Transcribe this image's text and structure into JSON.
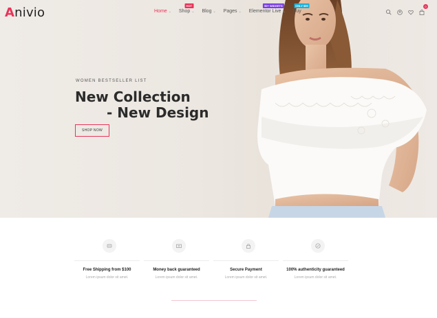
{
  "header": {
    "logo_first": "A",
    "logo_rest": "nivio",
    "nav": [
      {
        "label": "Home",
        "active": true,
        "dropdown": true,
        "badge": ""
      },
      {
        "label": "Shop",
        "active": false,
        "dropdown": true,
        "badge": "HOT",
        "badge_color": "#e8345a"
      },
      {
        "label": "Blog",
        "active": false,
        "dropdown": true,
        "badge": ""
      },
      {
        "label": "Pages",
        "active": false,
        "dropdown": true,
        "badge": ""
      },
      {
        "label": "Elementor Live",
        "active": false,
        "dropdown": true,
        "badge": "50+ WIDGETS",
        "badge_color": "#7b3fe4"
      },
      {
        "label": "Buy",
        "active": false,
        "dropdown": false,
        "badge": "ONLY $59",
        "badge_color": "#1ab0d8"
      }
    ],
    "icons": [
      "search-icon",
      "user-icon",
      "heart-icon",
      "cart-icon"
    ],
    "cart_count": "0"
  },
  "hero": {
    "eyebrow": "WOMEN BESTSELLER LIST",
    "title_line1": "New Collection",
    "title_line2": "- New Design",
    "button": "SHOP NOW"
  },
  "features": [
    {
      "icon": "truck-icon",
      "title": "Free Shipping from $100",
      "subtitle": "Lorem ipsum dolor sit amet."
    },
    {
      "icon": "money-icon",
      "title": "Money back guaranteed",
      "subtitle": "Lorem ipsum dolor sit amet."
    },
    {
      "icon": "lock-icon",
      "title": "Secure Payment",
      "subtitle": "Lorem ipsum dolor sit amet."
    },
    {
      "icon": "badge-check-icon",
      "title": "100% authenticity guaranteed",
      "subtitle": "Lorem ipsum dolor sit amet."
    }
  ],
  "colors": {
    "accent": "#e8345a",
    "hero_bg": "#ece7e1"
  }
}
